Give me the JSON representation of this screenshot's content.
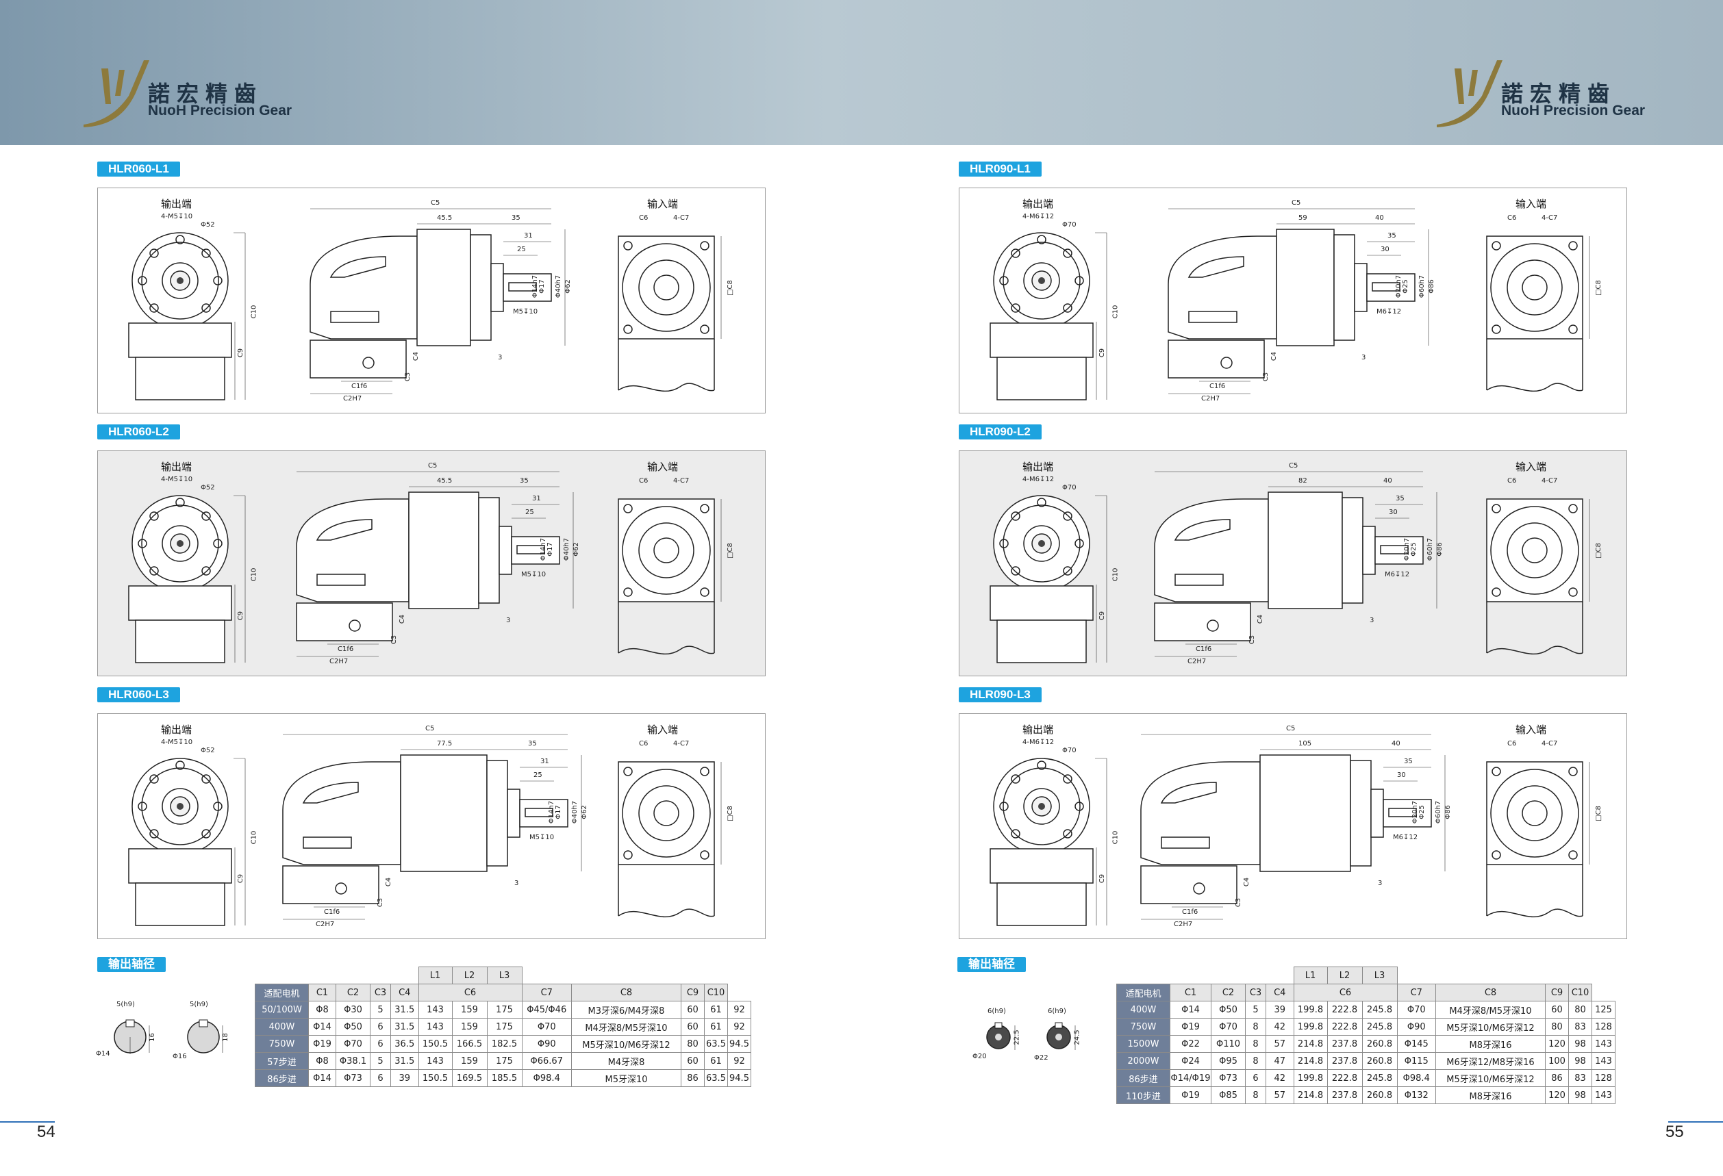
{
  "brand": {
    "cn": "諾宏精齒",
    "en": "NuoH Precision Gear"
  },
  "colors": {
    "accent": "#1ea3df",
    "header_row": "#6f7f99",
    "page_line": "#2f70b8"
  },
  "labels": {
    "output_end": "输出端",
    "input_end": "输入端",
    "shaft_diameter": "输出轴径"
  },
  "left": {
    "page_number": "54",
    "sections": [
      {
        "tag": "HLR060-L1",
        "hole": "4-M5↧10",
        "flange": "Φ52",
        "c5_parts": [
          "45.5",
          "35"
        ],
        "shaft_dims": [
          "31",
          "25",
          "3"
        ],
        "tap": "M5↧10",
        "dias": [
          "Φ14h7",
          "Φ17",
          "Φ40h7",
          "Φ62"
        ]
      },
      {
        "tag": "HLR060-L2",
        "hole": "4-M5↧10",
        "flange": "Φ52",
        "c5_parts": [
          "45.5",
          "35"
        ],
        "shaft_dims": [
          "31",
          "25",
          "3"
        ],
        "tap": "M5↧10",
        "dias": [
          "Φ14h7",
          "Φ17",
          "Φ40h7",
          "Φ62"
        ]
      },
      {
        "tag": "HLR060-L3",
        "hole": "4-M5↧10",
        "flange": "Φ52",
        "c5_parts": [
          "77.5",
          "35"
        ],
        "shaft_dims": [
          "31",
          "25",
          "3"
        ],
        "tap": "M5↧10",
        "dias": [
          "Φ14h7",
          "Φ17",
          "Φ40h7",
          "Φ62"
        ]
      }
    ],
    "shafts": [
      {
        "key": "5(h9)",
        "height": "16",
        "dia": "Φ14"
      },
      {
        "key": "5(h9)",
        "height": "18",
        "dia": "Φ16"
      }
    ],
    "table": {
      "group": [
        "L1",
        "L2",
        "L3"
      ],
      "headers": [
        "适配电机",
        "C1",
        "C2",
        "C3",
        "C4",
        "C6",
        "C7",
        "C8",
        "C9",
        "C10"
      ],
      "rows": [
        [
          "50/100W",
          "Φ8",
          "Φ30",
          "5",
          "31.5",
          "143",
          "159",
          "175",
          "Φ45/Φ46",
          "M3牙深6/M4牙深8",
          "60",
          "61",
          "92"
        ],
        [
          "400W",
          "Φ14",
          "Φ50",
          "6",
          "31.5",
          "143",
          "159",
          "175",
          "Φ70",
          "M4牙深8/M5牙深10",
          "60",
          "61",
          "92"
        ],
        [
          "750W",
          "Φ19",
          "Φ70",
          "6",
          "36.5",
          "150.5",
          "166.5",
          "182.5",
          "Φ90",
          "M5牙深10/M6牙深12",
          "80",
          "63.5",
          "94.5"
        ],
        [
          "57步进",
          "Φ8",
          "Φ38.1",
          "5",
          "31.5",
          "143",
          "159",
          "175",
          "Φ66.67",
          "M4牙深8",
          "60",
          "61",
          "92"
        ],
        [
          "86步进",
          "Φ14",
          "Φ73",
          "6",
          "39",
          "150.5",
          "169.5",
          "185.5",
          "Φ98.4",
          "M5牙深10",
          "86",
          "63.5",
          "94.5"
        ]
      ]
    }
  },
  "right": {
    "page_number": "55",
    "sections": [
      {
        "tag": "HLR090-L1",
        "hole": "4-M6↧12",
        "flange": "Φ70",
        "c5_parts": [
          "59",
          "40"
        ],
        "shaft_dims": [
          "35",
          "30",
          "3"
        ],
        "tap": "M6↧12",
        "dias": [
          "Φ20h7",
          "Φ25",
          "Φ60h7",
          "Φ86"
        ]
      },
      {
        "tag": "HLR090-L2",
        "hole": "4-M6↧12",
        "flange": "Φ70",
        "c5_parts": [
          "82",
          "40"
        ],
        "shaft_dims": [
          "35",
          "30",
          "3"
        ],
        "tap": "M6↧12",
        "dias": [
          "Φ20h7",
          "Φ25",
          "Φ60h7",
          "Φ86"
        ]
      },
      {
        "tag": "HLR090-L3",
        "hole": "4-M6↧12",
        "flange": "Φ70",
        "c5_parts": [
          "105",
          "40"
        ],
        "shaft_dims": [
          "35",
          "30",
          "3"
        ],
        "tap": "M6↧12",
        "dias": [
          "Φ20h7",
          "Φ25",
          "Φ60h7",
          "Φ86"
        ]
      }
    ],
    "shafts": [
      {
        "key": "6(h9)",
        "height": "22.5",
        "dia": "Φ20"
      },
      {
        "key": "6(h9)",
        "height": "24.5",
        "dia": "Φ22"
      }
    ],
    "table": {
      "group": [
        "L1",
        "L2",
        "L3"
      ],
      "headers": [
        "适配电机",
        "C1",
        "C2",
        "C3",
        "C4",
        "C6",
        "C7",
        "C8",
        "C9",
        "C10"
      ],
      "rows": [
        [
          "400W",
          "Φ14",
          "Φ50",
          "5",
          "39",
          "199.8",
          "222.8",
          "245.8",
          "Φ70",
          "M4牙深8/M5牙深10",
          "60",
          "80",
          "125"
        ],
        [
          "750W",
          "Φ19",
          "Φ70",
          "8",
          "42",
          "199.8",
          "222.8",
          "245.8",
          "Φ90",
          "M5牙深10/M6牙深12",
          "80",
          "83",
          "128"
        ],
        [
          "1500W",
          "Φ22",
          "Φ110",
          "8",
          "57",
          "214.8",
          "237.8",
          "260.8",
          "Φ145",
          "M8牙深16",
          "120",
          "98",
          "143"
        ],
        [
          "2000W",
          "Φ24",
          "Φ95",
          "8",
          "47",
          "214.8",
          "237.8",
          "260.8",
          "Φ115",
          "M6牙深12/M8牙深16",
          "100",
          "98",
          "143"
        ],
        [
          "86步进",
          "Φ14/Φ19",
          "Φ73",
          "6",
          "42",
          "199.8",
          "222.8",
          "245.8",
          "Φ98.4",
          "M5牙深10/M6牙深12",
          "86",
          "83",
          "128"
        ],
        [
          "110步进",
          "Φ19",
          "Φ85",
          "8",
          "57",
          "214.8",
          "237.8",
          "260.8",
          "Φ132",
          "M8牙深16",
          "120",
          "98",
          "143"
        ]
      ]
    }
  }
}
